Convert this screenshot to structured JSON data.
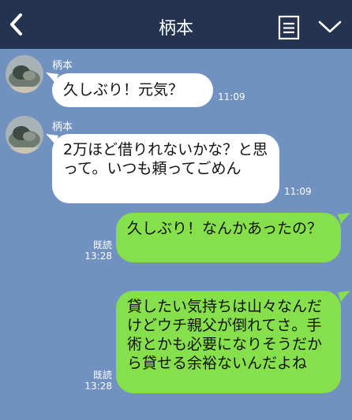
{
  "header": {
    "title": "柄本"
  },
  "messages": [
    {
      "side": "in",
      "sender": "柄本",
      "text": "久しぶり！元気？",
      "time": "11:09"
    },
    {
      "side": "in",
      "sender": "柄本",
      "text": "2万ほど借りれないかな？と思って。いつも頼ってごめん",
      "time": "11:09"
    },
    {
      "side": "out",
      "text": "久しぶり！なんかあったの？",
      "read": "既読",
      "time": "13:28"
    },
    {
      "side": "out",
      "text": "貸したい気持ちは山々なんだけどウチ親父が倒れてさ。手術とかも必要になりそうだから貸せる余裕ないんだよね",
      "read": "既読",
      "time": "13:28"
    }
  ],
  "colors": {
    "chat_background": "#7191c0",
    "header_background": "#243450",
    "outgoing_bubble": "#86e04c",
    "incoming_bubble": "#ffffff"
  },
  "icons": [
    "back-icon",
    "memo-icon",
    "chevron-down-icon"
  ]
}
